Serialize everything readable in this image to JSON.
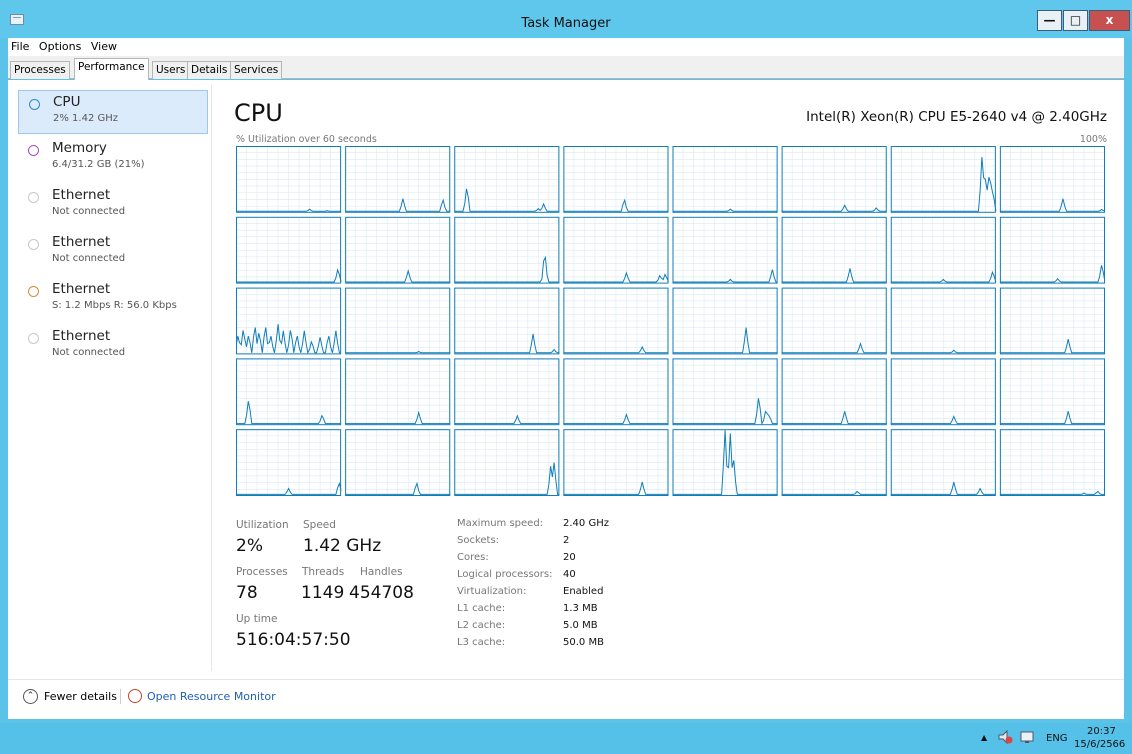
{
  "window": {
    "title": "Task Manager"
  },
  "menu": [
    "File",
    "Options",
    "View"
  ],
  "tabs": [
    "Processes",
    "Performance",
    "Users",
    "Details",
    "Services"
  ],
  "active_tab": "Performance",
  "sidebar": [
    {
      "label": "CPU",
      "sub": "2% 1.42 GHz",
      "color": "#2b8cc4",
      "selected": true
    },
    {
      "label": "Memory",
      "sub": "6.4/31.2 GB (21%)",
      "color": "#a54fc1",
      "selected": false
    },
    {
      "label": "Ethernet",
      "sub": "Not connected",
      "color": "#c8c8c8",
      "selected": false
    },
    {
      "label": "Ethernet",
      "sub": "Not connected",
      "color": "#c8c8c8",
      "selected": false
    },
    {
      "label": "Ethernet",
      "sub": "S: 1.2 Mbps R: 56.0 Kbps",
      "color": "#d48b3c",
      "selected": false
    },
    {
      "label": "Ethernet",
      "sub": "Not connected",
      "color": "#c8c8c8",
      "selected": false
    }
  ],
  "main": {
    "title": "CPU",
    "model": "Intel(R) Xeon(R) CPU E5-2640 v4 @ 2.40GHz",
    "util_caption": "% Utilization over 60 seconds",
    "max_pct": "100%",
    "graph_color": "#117dbb",
    "graph_border": "#117dbb",
    "graph_grid": "#d9eaf4"
  },
  "chart_data": {
    "type": "line",
    "title": "CPU",
    "ylabel": "% Utilization over 60 seconds",
    "ylim": [
      0,
      100
    ],
    "grid": true,
    "logical_processors": 40,
    "series": [
      [
        [
          0.7,
          0.04
        ],
        [
          0.87,
          0.02
        ]
      ],
      [
        [
          0.55,
          0.2
        ],
        [
          0.93,
          0.2
        ]
      ],
      [
        [
          0.12,
          0.4
        ],
        [
          0.8,
          0.05
        ],
        [
          0.85,
          0.12
        ]
      ],
      [
        [
          0.58,
          0.2
        ]
      ],
      [
        [
          0.55,
          0.04
        ]
      ],
      [
        [
          0.6,
          0.1
        ],
        [
          0.9,
          0.06
        ]
      ],
      [
        [
          0.87,
          0.95
        ],
        [
          0.9,
          0.5
        ],
        [
          0.93,
          0.6
        ],
        [
          0.95,
          0.45
        ],
        [
          0.97,
          0.35
        ]
      ],
      [
        [
          0.6,
          0.2
        ],
        [
          0.97,
          0.04
        ]
      ],
      [
        [
          0.97,
          0.22
        ]
      ],
      [
        [
          0.6,
          0.18
        ]
      ],
      [
        [
          0.86,
          0.5
        ]
      ],
      [
        [
          0.6,
          0.15
        ],
        [
          0.92,
          0.12
        ],
        [
          0.97,
          0.14
        ]
      ],
      [
        [
          0.55,
          0.05
        ],
        [
          0.95,
          0.2
        ]
      ],
      [
        [
          0.65,
          0.22
        ]
      ],
      [
        [
          0.5,
          0.05
        ],
        [
          0.97,
          0.18
        ]
      ],
      [
        [
          0.55,
          0.06
        ],
        [
          0.97,
          0.3
        ]
      ],
      [
        [
          0.02,
          0.3
        ],
        [
          0.07,
          0.4
        ],
        [
          0.12,
          0.3
        ],
        [
          0.18,
          0.45
        ],
        [
          0.22,
          0.35
        ],
        [
          0.28,
          0.45
        ],
        [
          0.33,
          0.3
        ],
        [
          0.4,
          0.45
        ],
        [
          0.45,
          0.35
        ],
        [
          0.52,
          0.4
        ],
        [
          0.58,
          0.3
        ],
        [
          0.65,
          0.35
        ],
        [
          0.72,
          0.2
        ],
        [
          0.8,
          0.25
        ],
        [
          0.88,
          0.3
        ],
        [
          0.95,
          0.35
        ]
      ],
      [
        [
          0.7,
          0.03
        ]
      ],
      [
        [
          0.75,
          0.3
        ],
        [
          0.95,
          0.06
        ]
      ],
      [
        [
          0.75,
          0.1
        ]
      ],
      [
        [
          0.7,
          0.4
        ]
      ],
      [
        [
          0.75,
          0.15
        ]
      ],
      [
        [
          0.6,
          0.05
        ]
      ],
      [
        [
          0.65,
          0.22
        ]
      ],
      [
        [
          0.12,
          0.4
        ],
        [
          0.82,
          0.15
        ]
      ],
      [
        [
          0.7,
          0.18
        ]
      ],
      [
        [
          0.6,
          0.13
        ]
      ],
      [
        [
          0.6,
          0.15
        ]
      ],
      [
        [
          0.82,
          0.45
        ],
        [
          0.89,
          0.25
        ],
        [
          0.92,
          0.15
        ]
      ],
      [
        [
          0.6,
          0.2
        ]
      ],
      [
        [
          0.6,
          0.12
        ]
      ],
      [
        [
          0.65,
          0.2
        ]
      ],
      [
        [
          0.5,
          0.1
        ],
        [
          0.98,
          0.2
        ]
      ],
      [
        [
          0.68,
          0.2
        ]
      ],
      [
        [
          0.92,
          0.5
        ],
        [
          0.95,
          0.5
        ]
      ],
      [
        [
          0.75,
          0.2
        ]
      ],
      [
        [
          0.5,
          1.0
        ],
        [
          0.55,
          0.95
        ],
        [
          0.58,
          0.6
        ]
      ],
      [
        [
          0.72,
          0.06
        ]
      ],
      [
        [
          0.6,
          0.2
        ],
        [
          0.85,
          0.1
        ]
      ],
      [
        [
          0.8,
          0.03
        ],
        [
          0.93,
          0.06
        ]
      ]
    ]
  },
  "stats": {
    "utilization_label": "Utilization",
    "utilization": "2%",
    "speed_label": "Speed",
    "speed": "1.42 GHz",
    "processes_label": "Processes",
    "processes": "78",
    "threads_label": "Threads",
    "threads": "1149",
    "handles_label": "Handles",
    "handles": "454708",
    "uptime_label": "Up time",
    "uptime": "516:04:57:50"
  },
  "details": [
    {
      "label": "Maximum speed:",
      "value": "2.40 GHz"
    },
    {
      "label": "Sockets:",
      "value": "2"
    },
    {
      "label": "Cores:",
      "value": "20"
    },
    {
      "label": "Logical processors:",
      "value": "40"
    },
    {
      "label": "Virtualization:",
      "value": "Enabled"
    },
    {
      "label": "L1 cache:",
      "value": "1.3 MB"
    },
    {
      "label": "L2 cache:",
      "value": "5.0 MB"
    },
    {
      "label": "L3 cache:",
      "value": "50.0 MB"
    }
  ],
  "footer": {
    "fewer_details": "Fewer details",
    "resource_monitor": "Open Resource Monitor"
  },
  "taskbar": {
    "lang": "ENG",
    "time": "20:37",
    "date": "15/6/2566"
  }
}
